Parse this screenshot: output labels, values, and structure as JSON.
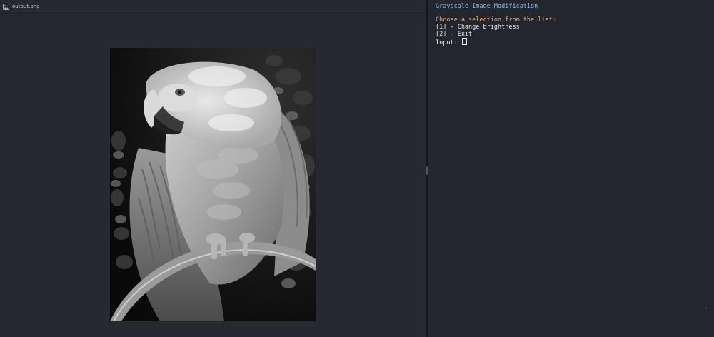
{
  "viewer": {
    "tab_label": "output.png",
    "tab_icon": "image-file-icon",
    "image_alt": "grayscale parrot"
  },
  "terminal": {
    "title": "Grayscale Image Modification",
    "prompt": "Choose a selection from the list:",
    "options": [
      "[1] - Change brightness",
      "[2] - Exit"
    ],
    "input_label": "Input: ",
    "colors": {
      "title": "#8fb8ea",
      "prompt": "#e0a575",
      "text": "#e6e7ec",
      "background": "#23252f"
    }
  }
}
